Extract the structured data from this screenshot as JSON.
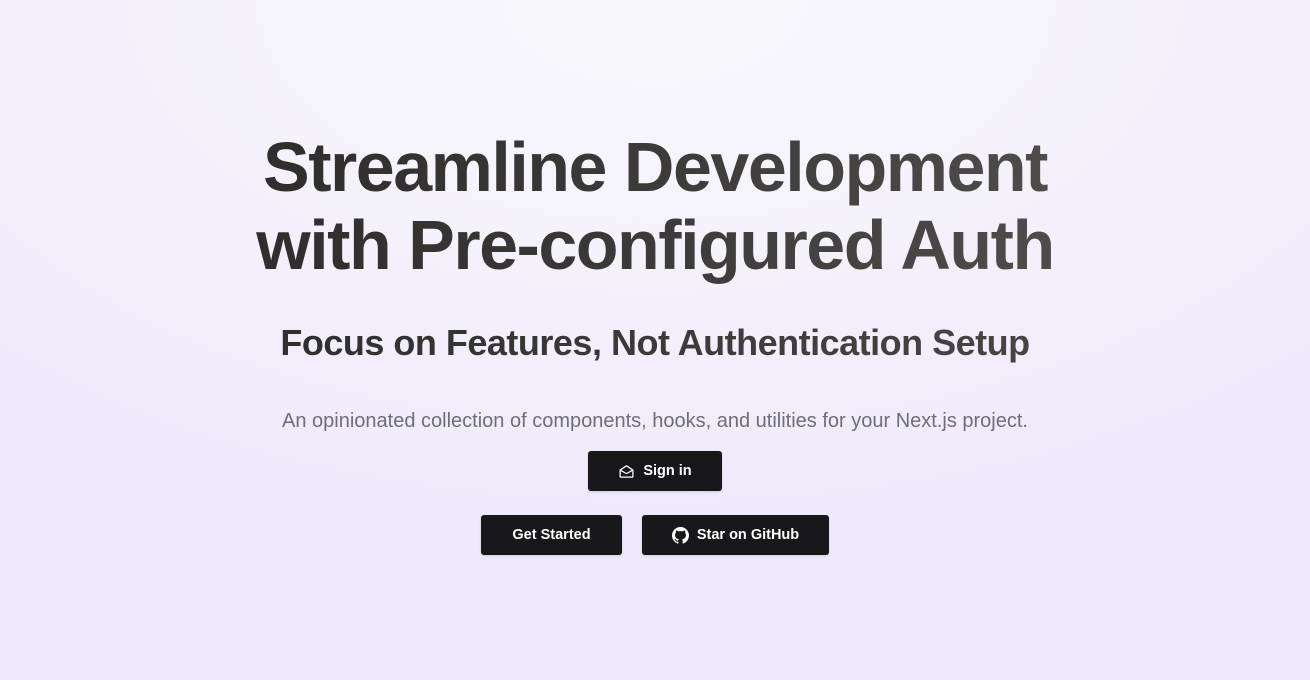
{
  "hero": {
    "headline_line1": "Streamline Development",
    "headline_line2": "with Pre-configured Auth",
    "subheadline": "Focus on Features, Not Authentication Setup",
    "description": "An opinionated collection of components, hooks, and utilities for your Next.js project."
  },
  "actions": {
    "sign_in": {
      "label": "Sign in",
      "icon": "mail-open-icon"
    },
    "get_started": {
      "label": "Get Started"
    },
    "github": {
      "label": "Star on GitHub",
      "icon": "github-icon"
    }
  },
  "colors": {
    "button_bg": "#18181b",
    "button_text": "#ffffff",
    "description_text": "#6e6e78",
    "background": "#f4f1fb"
  }
}
